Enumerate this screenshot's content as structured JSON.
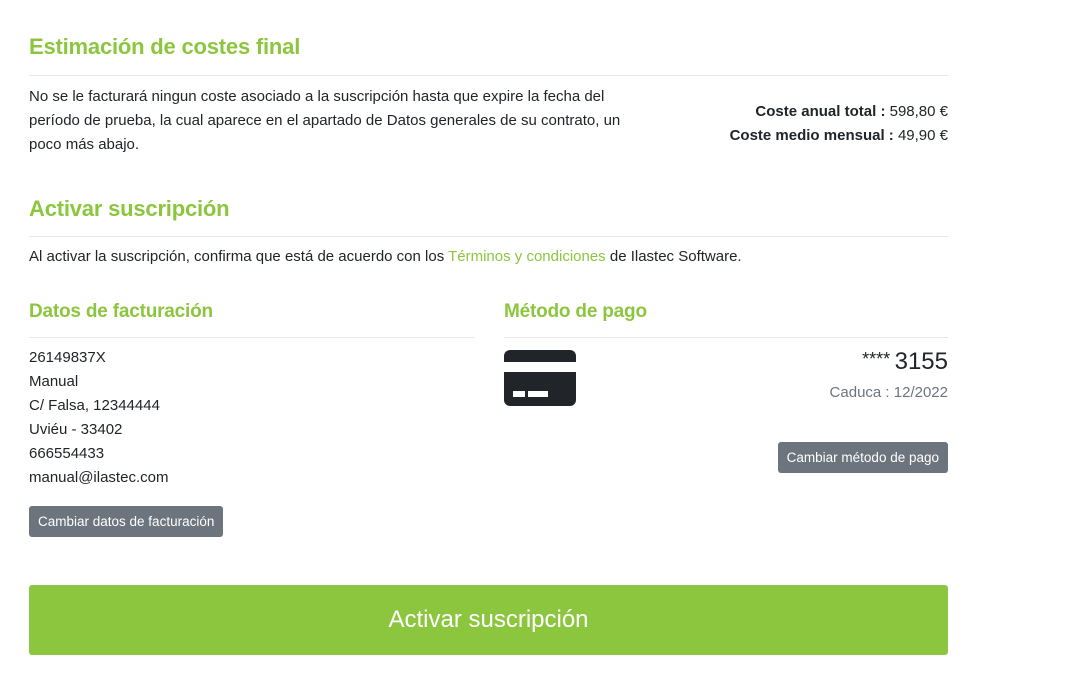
{
  "estimate": {
    "title": "Estimación de costes final",
    "description": "No se le facturará ningun coste asociado a la suscripción hasta que expire la fecha del período de prueba, la cual aparece en el apartado de Datos generales de su contrato, un poco más abajo.",
    "annual_label": "Coste anual total :",
    "annual_value": "598,80 €",
    "monthly_label": "Coste medio mensual :",
    "monthly_value": "49,90 €"
  },
  "activate": {
    "title": "Activar suscripción",
    "terms_prefix": "Al activar la suscripción, confirma que está de acuerdo con los ",
    "terms_link": "Términos y condiciones",
    "terms_suffix": " de Ilastec Software.",
    "button_label": "Activar suscripción"
  },
  "billing": {
    "title": "Datos de facturación",
    "lines": [
      "26149837X",
      "Manual",
      "C/ Falsa, 12344444",
      "Uviéu - 33402",
      "666554433",
      "manual@ilastec.com"
    ],
    "button_label": "Cambiar datos de facturación"
  },
  "payment": {
    "title": "Método de pago",
    "card_icon": "credit-card-icon",
    "card_mask": "****",
    "card_last4": "3155",
    "expiry_label": "Caduca :",
    "expiry_value": "12/2022",
    "button_label": "Cambiar método de pago"
  },
  "colors": {
    "accent": "#8cc63f",
    "secondary_button": "#6c757d",
    "card_icon": "#212529",
    "muted_text": "#6c757d"
  }
}
